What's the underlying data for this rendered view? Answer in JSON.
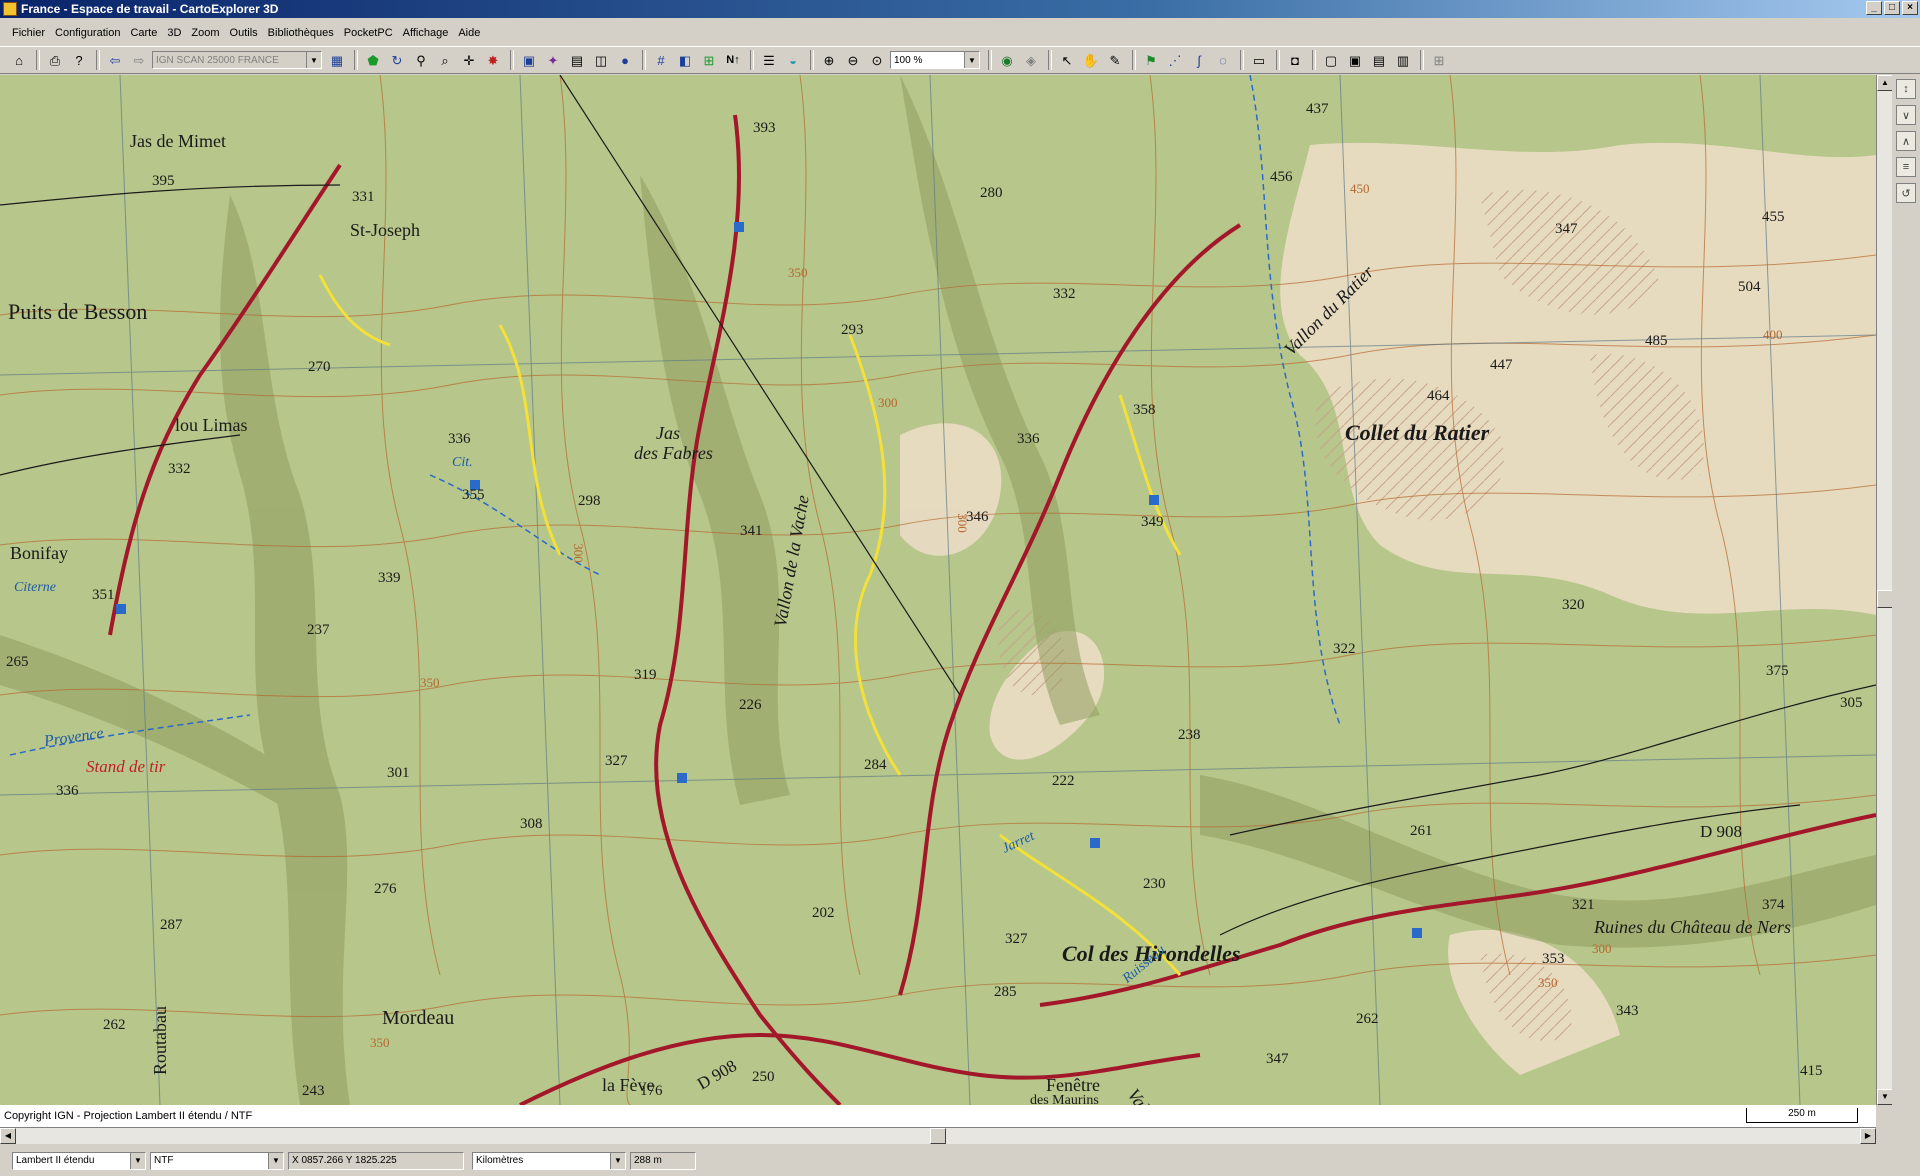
{
  "window": {
    "title": "France - Espace de travail - CartoExplorer 3D"
  },
  "menu": [
    "Fichier",
    "Configuration",
    "Carte",
    "3D",
    "Zoom",
    "Outils",
    "Bibliothèques",
    "PocketPC",
    "Affichage",
    "Aide"
  ],
  "toolbar": {
    "map_layer": "IGN SCAN 25000 FRANCE",
    "zoom_value": "100 %"
  },
  "map": {
    "labels": {
      "collet_du_ratier": "Collet du Ratier",
      "col_des_hirondelles": "Col des Hirondelles",
      "puits_de_besson": "Puits de Besson",
      "jas_de_mimet": "Jas de Mimet",
      "st_joseph": "St-Joseph",
      "lou_limas": "lou Limas",
      "bonifay": "Bonifay",
      "jas_des_fabres_1": "Jas",
      "jas_des_fabres_2": "des Fabres",
      "vallon_de_la_vache": "Vallon de la Vache",
      "vallon_du_ratier": "Vallon du Ratier",
      "vallon_de": "Vallon de l'",
      "ruines": "Ruines du Château de Ners",
      "mordeau": "Mordeau",
      "la_feve": "la Fève",
      "fenetre_1": "Fenêtre",
      "fenetre_2": "des Maurins",
      "routabau": "Routabau",
      "provence": "Provence",
      "stand_de_tir": "Stand de tir",
      "citerne": "Citerne",
      "d908_east": "D 908",
      "d908_south": "D 908",
      "ruisseau": "Ruisseau",
      "jarret": "Jarret",
      "cit": "Cit."
    },
    "elevations": [
      "393",
      "437",
      "456",
      "395",
      "331",
      "280",
      "347",
      "455",
      "332",
      "504",
      "293",
      "485",
      "447",
      "464",
      "270",
      "358",
      "336",
      "336",
      "332",
      "355",
      "298",
      "341",
      "346",
      "349",
      "339",
      "351",
      "237",
      "265",
      "319",
      "226",
      "322",
      "320",
      "375",
      "305",
      "327",
      "284",
      "222",
      "238",
      "336",
      "301",
      "308",
      "261",
      "276",
      "202",
      "230",
      "321",
      "374",
      "287",
      "327",
      "353",
      "285",
      "262",
      "262",
      "343",
      "243",
      "176",
      "250",
      "347",
      "415"
    ],
    "contours": [
      "350",
      "300",
      "300",
      "350",
      "400",
      "450",
      "350",
      "300",
      "300",
      "350"
    ]
  },
  "footer": {
    "copyright": "Copyright IGN - Projection Lambert II étendu / NTF",
    "scale": "250 m"
  },
  "status": {
    "projection": "Lambert II étendu",
    "datum": "NTF",
    "coords": "X 0857.266  Y 1825.225",
    "units": "Kilomètres",
    "altitude": "288 m"
  },
  "colors": {
    "forest": "#b7c68a",
    "clearing": "#e7d8b8",
    "contour": "#b5672e",
    "road_red": "#a3172a",
    "road_yellow": "#f3e03a",
    "water": "#2a6bc9",
    "grid": "#5f7a88"
  }
}
